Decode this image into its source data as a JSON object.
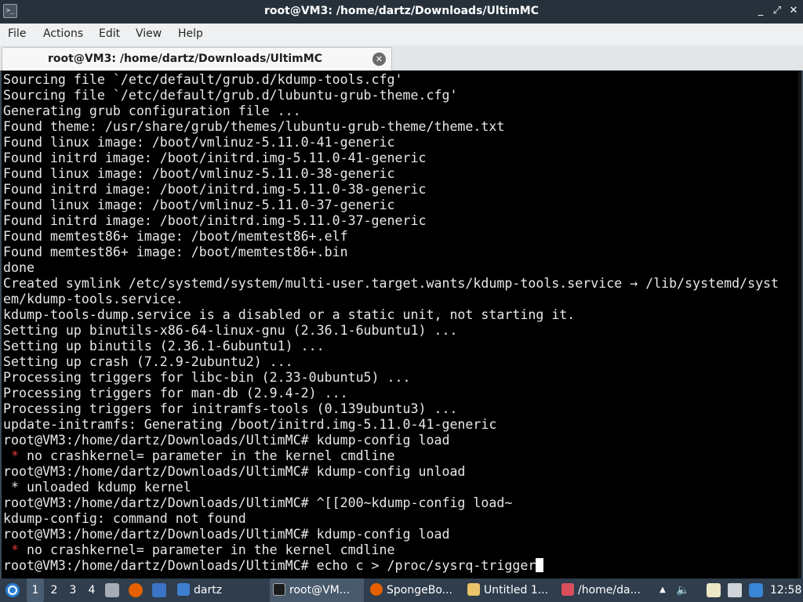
{
  "window": {
    "title": "root@VM3: /home/dartz/Downloads/UltimMC",
    "icon": "terminal-icon",
    "controls": {
      "minimize": "_",
      "maximize": "⤢",
      "close": "✕"
    }
  },
  "menu": {
    "items": [
      "File",
      "Actions",
      "Edit",
      "View",
      "Help"
    ]
  },
  "tab": {
    "label": "root@VM3: /home/dartz/Downloads/UltimMC",
    "close": "✕"
  },
  "terminal": {
    "lines": [
      "Sourcing file `/etc/default/grub.d/kdump-tools.cfg'",
      "Sourcing file `/etc/default/grub.d/lubuntu-grub-theme.cfg'",
      "Generating grub configuration file ...",
      "Found theme: /usr/share/grub/themes/lubuntu-grub-theme/theme.txt",
      "Found linux image: /boot/vmlinuz-5.11.0-41-generic",
      "Found initrd image: /boot/initrd.img-5.11.0-41-generic",
      "Found linux image: /boot/vmlinuz-5.11.0-38-generic",
      "Found initrd image: /boot/initrd.img-5.11.0-38-generic",
      "Found linux image: /boot/vmlinuz-5.11.0-37-generic",
      "Found initrd image: /boot/initrd.img-5.11.0-37-generic",
      "Found memtest86+ image: /boot/memtest86+.elf",
      "Found memtest86+ image: /boot/memtest86+.bin",
      "done",
      "Created symlink /etc/systemd/system/multi-user.target.wants/kdump-tools.service → /lib/systemd/syst",
      "em/kdump-tools.service.",
      "kdump-tools-dump.service is a disabled or a static unit, not starting it.",
      "Setting up binutils-x86-64-linux-gnu (2.36.1-6ubuntu1) ...",
      "Setting up binutils (2.36.1-6ubuntu1) ...",
      "Setting up crash (7.2.9-2ubuntu2) ...",
      "Processing triggers for libc-bin (2.33-0ubuntu5) ...",
      "Processing triggers for man-db (2.9.4-2) ...",
      "Processing triggers for initramfs-tools (0.139ubuntu3) ...",
      "update-initramfs: Generating /boot/initrd.img-5.11.0-41-generic",
      "root@VM3:/home/dartz/Downloads/UltimMC# kdump-config load",
      "{S} no crashkernel= parameter in the kernel cmdline",
      "root@VM3:/home/dartz/Downloads/UltimMC# kdump-config unload",
      " * unloaded kdump kernel",
      "root@VM3:/home/dartz/Downloads/UltimMC# ^[[200~kdump-config load~",
      "kdump-config: command not found",
      "root@VM3:/home/dartz/Downloads/UltimMC# kdump-config load",
      "{S} no crashkernel= parameter in the kernel cmdline",
      "root@VM3:/home/dartz/Downloads/UltimMC# echo c > /proc/sysrq-trigger"
    ],
    "error_star": " *",
    "star_color": "#e23b3b"
  },
  "taskbar": {
    "workspaces": [
      "1",
      "2",
      "3",
      "4"
    ],
    "active_workspace": "1",
    "launchers": [
      "lubuntu-menu-icon",
      "show-desktop-icon",
      "firefox-icon",
      "file-manager-icon"
    ],
    "tasks": [
      {
        "label": "dartz",
        "icon": "folder-icon"
      },
      {
        "label": "root@VM...",
        "icon": "terminal-icon",
        "active": true
      },
      {
        "label": "SpongeBo...",
        "icon": "firefox-icon"
      },
      {
        "label": "Untitled 1...",
        "icon": "text-editor-icon"
      },
      {
        "label": "/home/da...",
        "icon": "image-viewer-icon"
      }
    ],
    "tray": [
      "tray-arrow-icon",
      "volume-icon",
      "clipboard-icon",
      "network-icon",
      "bluetooth-icon"
    ],
    "clock": "12:58"
  },
  "colors": {
    "titlebar_bg": "#27313c",
    "taskbar_bg": "#2f3d4c",
    "terminal_bg": "#000000",
    "terminal_fg": "#e8e8e8"
  }
}
